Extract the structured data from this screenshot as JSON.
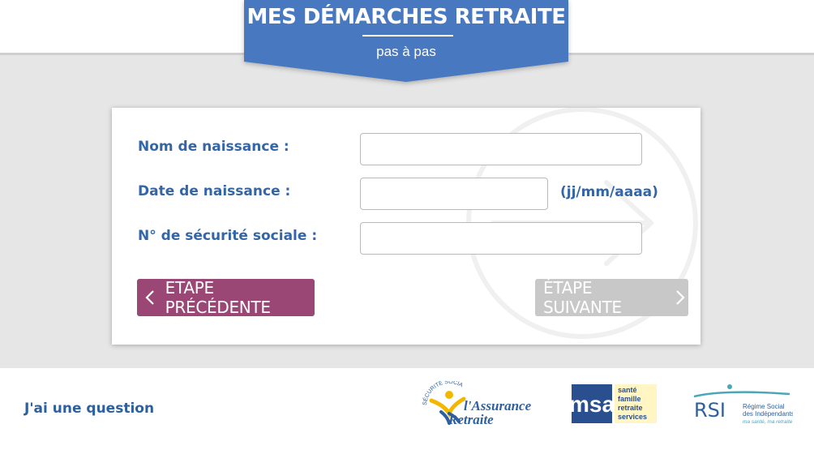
{
  "header": {
    "title": "MES DÉMARCHES RETRAITE",
    "subtitle": "pas à pas",
    "banner_color": "#4878bf"
  },
  "form": {
    "fields": [
      {
        "label": "Nom de naissance :",
        "value": "",
        "placeholder": ""
      },
      {
        "label": "Date de naissance :",
        "value": "",
        "placeholder": "",
        "hint": "(jj/mm/aaaa)"
      },
      {
        "label": "N° de sécurité sociale :",
        "value": "",
        "placeholder": ""
      }
    ],
    "prev_button": {
      "label": "ETAPE PRÉCÉDENTE",
      "icon": "chevron-left-icon",
      "color": "#9a4775"
    },
    "next_button": {
      "label": "ÉTAPE SUIVANTE",
      "icon": "chevron-right-icon",
      "color": "#c8c8c8",
      "state": "disabled"
    },
    "watermark_icon": "circle-arrow-right-icon"
  },
  "footer": {
    "question_link": "J'ai une question",
    "logos": [
      {
        "name": "assurance-retraite",
        "top_arc": "SÉCURITÉ SOCIALE",
        "line1": "l'Assurance",
        "line2": "Retraite"
      },
      {
        "name": "msa",
        "letters": "msa",
        "lines": [
          "santé",
          "famille",
          "retraite",
          "services"
        ]
      },
      {
        "name": "rsi",
        "acronym": "RSI",
        "lines": [
          "Régime Social",
          "des Indépendants"
        ],
        "tagline": "ma santé, ma retraite"
      }
    ]
  }
}
